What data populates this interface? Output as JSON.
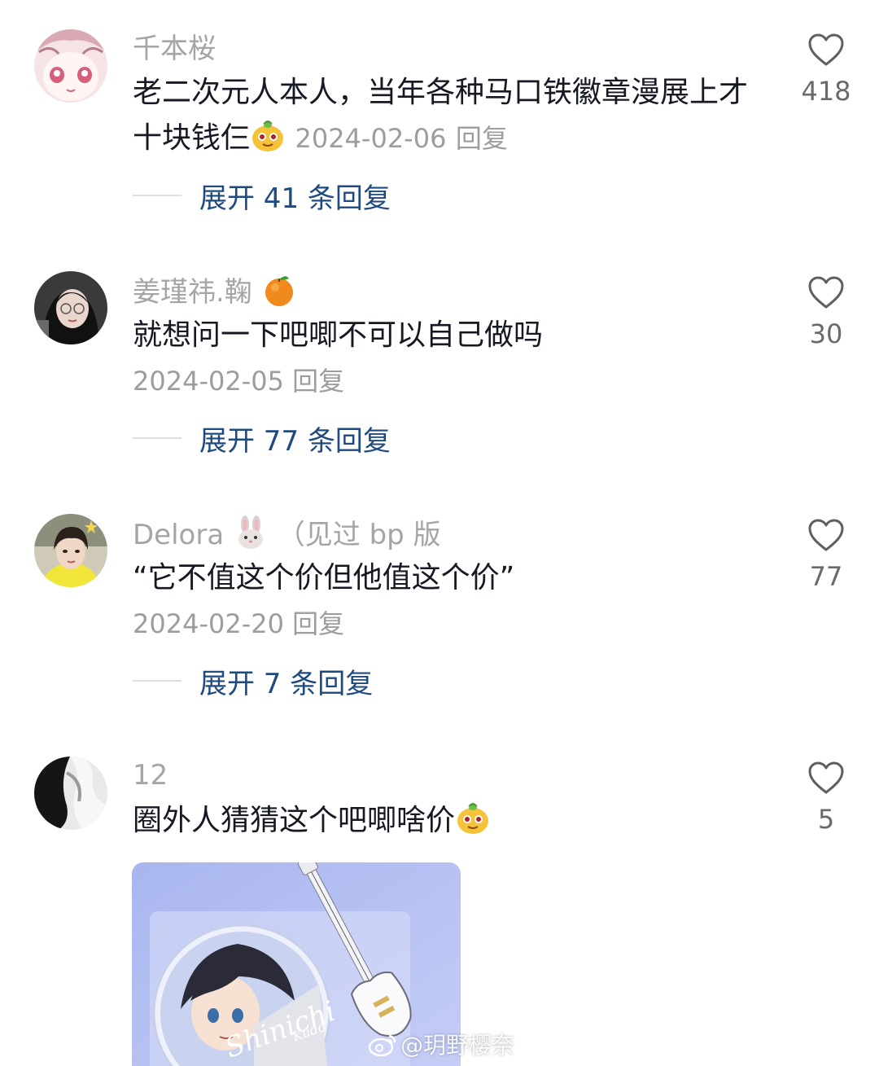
{
  "comments": [
    {
      "username": "千本桜",
      "username_emoji": "",
      "username_suffix": "",
      "text": "老二次元人本人，当年各种马口铁徽章漫展上才十块钱仨",
      "text_emoji": "orange-face-emoji",
      "date": "2024-02-06",
      "reply_label": "回复",
      "likes": "418",
      "expand_label": "展开 41 条回复"
    },
    {
      "username": "姜瑾祎.鞠",
      "username_emoji": "tangerine-emoji",
      "username_suffix": "",
      "text": "就想问一下吧唧不可以自己做吗",
      "text_emoji": "",
      "date": "2024-02-05",
      "reply_label": "回复",
      "likes": "30",
      "expand_label": "展开 77 条回复"
    },
    {
      "username": "Delora",
      "username_emoji": "rabbit-emoji",
      "username_suffix": "（见过 bp 版",
      "text": "“它不值这个价但他值这个价”",
      "text_emoji": "",
      "date": "2024-02-20",
      "reply_label": "回复",
      "likes": "77",
      "expand_label": "展开 7 条回复"
    },
    {
      "username": "12",
      "username_emoji": "",
      "username_suffix": "",
      "text": "圈外人猜猜这个吧唧啥价",
      "text_emoji": "orange-face-emoji",
      "date": "",
      "reply_label": "",
      "likes": "5",
      "expand_label": ""
    }
  ],
  "photo": {
    "badge_text": "Shinichi",
    "badge_subtext": "Kudo"
  },
  "watermark": "@玥野樱奈",
  "colors": {
    "username": "#a5a5a8",
    "text": "#161823",
    "meta": "#9d9da1",
    "expand": "#1f4a80",
    "like_count": "#6a6a6e"
  }
}
